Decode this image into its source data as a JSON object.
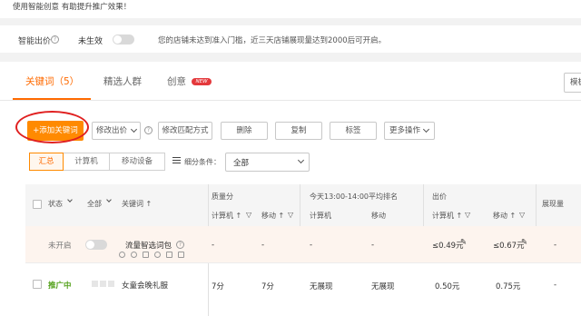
{
  "tip": {
    "text": "使用智能创意 有助提升推广效果！"
  },
  "smart_bid": {
    "label": "智能出价",
    "status": "未生效",
    "notice": "您的店铺未达到准入门槛，近三天店铺展现量达到2000后可开启。"
  },
  "tabs": [
    {
      "label": "关键词（5）",
      "active": true
    },
    {
      "label": "精选人群",
      "active": false
    },
    {
      "label": "创意",
      "active": false,
      "badge": "NEW"
    }
  ],
  "header_right_button": "模板",
  "toolbar": {
    "add_keyword": "+添加关键词",
    "modify_bid": "修改出价",
    "modify_match": "修改匹配方式",
    "delete": "删除",
    "copy": "复制",
    "tag": "标签",
    "more": "更多操作"
  },
  "device_segments": [
    "汇总",
    "计算机",
    "移动设备"
  ],
  "filter": {
    "label": "细分条件：",
    "value": "全部"
  },
  "table": {
    "headers": {
      "status": "状态",
      "all": "全部",
      "keyword": "关键词 ↑",
      "quality": "质量分",
      "rank": "今天13:00-14:00平均排名",
      "bid": "出价",
      "impressions": "展现量",
      "pc": "计算机 ↑",
      "mobile": "移动 ↑",
      "rank_pc": "计算机",
      "rank_mobile": "移动",
      "bid_pc": "计算机 ↑",
      "bid_mobile": "移动 ↑"
    },
    "rows": [
      {
        "status": "未开启",
        "keyword": "流量智选词包",
        "q_pc": "-",
        "q_mobile": "-",
        "rank_pc": "-",
        "rank_mobile": "-",
        "bid_pc": "≤0.49元",
        "bid_mobile": "≤0.67元",
        "impressions": "-"
      },
      {
        "status": "推广中",
        "keyword": "女童会晚礼服",
        "q_pc": "7分",
        "q_mobile": "7分",
        "rank_pc": "无展现",
        "rank_mobile": "无展现",
        "bid_pc": "0.50元",
        "bid_mobile": "0.75元",
        "impressions": "-"
      }
    ]
  },
  "colors": {
    "accent": "#ff6a00",
    "button_orange": "#ff8a00",
    "active_green": "#52a019",
    "annotation_red": "#e02020"
  }
}
